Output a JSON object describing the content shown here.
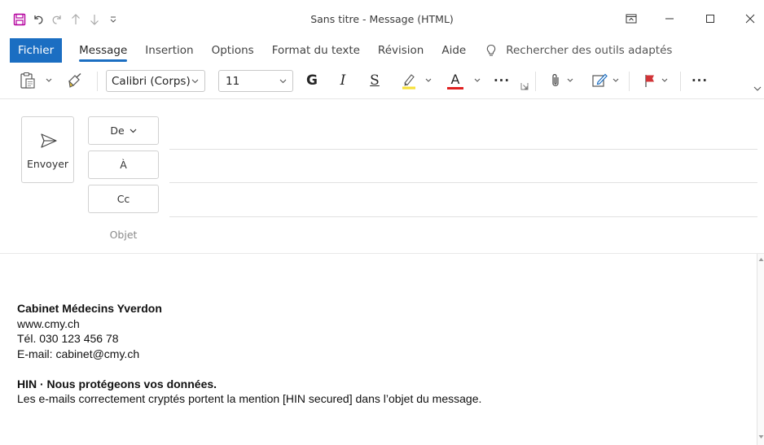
{
  "window": {
    "title": "Sans titre  -  Message (HTML)"
  },
  "tabs": [
    {
      "label": "Fichier"
    },
    {
      "label": "Message"
    },
    {
      "label": "Insertion"
    },
    {
      "label": "Options"
    },
    {
      "label": "Format du texte"
    },
    {
      "label": "Révision"
    },
    {
      "label": "Aide"
    }
  ],
  "search": {
    "placeholder": "Rechercher des outils adaptés"
  },
  "ribbon": {
    "font_name": "Calibri (Corps)",
    "font_size": "11",
    "bold": "G",
    "italic": "I",
    "underline": "S",
    "font_color_letter": "A",
    "more": "···",
    "highlight_color": "#f7e03b",
    "font_color": "#e02020"
  },
  "compose": {
    "send_label": "Envoyer",
    "from_label": "De",
    "to_label": "À",
    "cc_label": "Cc",
    "subject_label": "Objet"
  },
  "signature": {
    "org_name": "Cabinet Médecins Yverdon",
    "website": "www.cmy.ch",
    "phone": "Tél. 030 123 456 78",
    "email": "E-mail: cabinet@cmy.ch",
    "hin_title": "HIN · Nous protégeons vos données.",
    "hin_text": "Les e-mails correctement cryptés portent la mention [HIN secured] dans l’objet du message."
  },
  "colors": {
    "accent": "#1b6ec2",
    "save_icon": "#b4009e",
    "flag": "#d13438"
  }
}
